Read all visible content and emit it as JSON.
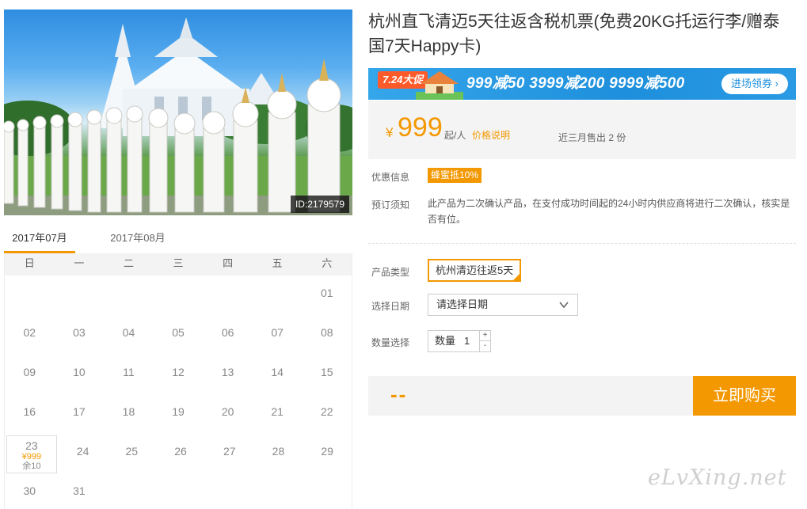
{
  "product": {
    "title": "杭州直飞清迈5天往返含税机票(免费20KG托运行李/赠泰国7天Happy卡)",
    "photo_id": "ID:2179579"
  },
  "promo": {
    "tag": "7.24大促",
    "text": "999减50  3999减200  9999减500",
    "button": "进场领券 ›"
  },
  "price": {
    "currency": "¥",
    "value": "999",
    "unit": "起/人",
    "link": "价格说明",
    "sold": "近三月售出 2 份"
  },
  "info": {
    "discount_label": "优惠信息",
    "discount_badge": "蜂蜜抵10%",
    "notice_label": "预订须知",
    "notice_text": "此产品为二次确认产品，在支付成功时间起的24小时内供应商将进行二次确认，核实是否有位。"
  },
  "options": {
    "type_label": "产品类型",
    "type_value": "杭州清迈往返5天",
    "date_label": "选择日期",
    "date_placeholder": "请选择日期",
    "qty_label": "数量选择",
    "qty_inner_label": "数量",
    "qty_value": "1",
    "plus": "+",
    "minus": "-"
  },
  "buy": {
    "total": "--",
    "button": "立即购买"
  },
  "calendar": {
    "tabs": [
      "2017年07月",
      "2017年08月"
    ],
    "weekdays": [
      "日",
      "一",
      "二",
      "三",
      "四",
      "五",
      "六"
    ],
    "weeks": [
      [
        "",
        "",
        "",
        "",
        "",
        "",
        "01"
      ],
      [
        "02",
        "03",
        "04",
        "05",
        "06",
        "07",
        "08"
      ],
      [
        "09",
        "10",
        "11",
        "12",
        "13",
        "14",
        "15"
      ],
      [
        "16",
        "17",
        "18",
        "19",
        "20",
        "21",
        "22"
      ],
      [
        "23",
        "24",
        "25",
        "26",
        "27",
        "28",
        "29"
      ],
      [
        "30",
        "31",
        "",
        "",
        "",
        "",
        ""
      ]
    ],
    "available": {
      "day": "23",
      "price": "¥999",
      "stock": "余10"
    }
  },
  "watermark": "eLvXing.net",
  "colors": {
    "accent": "#f39800",
    "banner": "#1e8fdc"
  }
}
